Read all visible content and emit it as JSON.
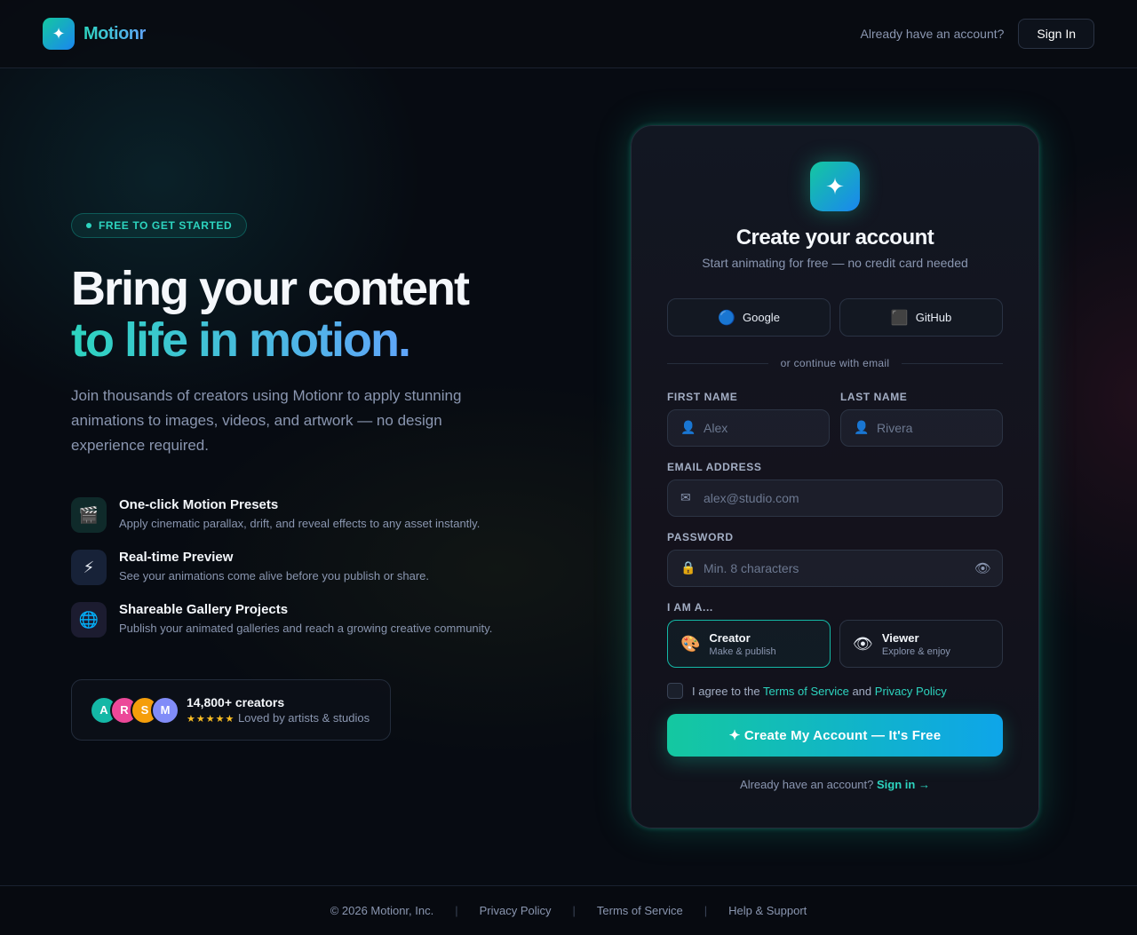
{
  "header": {
    "brand": "Motionr",
    "brand_icon": "sparkle-icon",
    "prompt": "Already have an account?",
    "signin_label": "Sign In"
  },
  "hero": {
    "badge": "FREE TO GET STARTED",
    "title_line1": "Bring your content",
    "title_line2": "to life in motion.",
    "description": "Join thousands of creators using Motionr to apply stunning animations to images, videos, and artwork — no design experience required.",
    "features": [
      {
        "icon": "🎬",
        "icon_name": "clapper-icon",
        "title": "One-click Motion Presets",
        "desc": "Apply cinematic parallax, drift, and reveal effects to any asset instantly."
      },
      {
        "icon": "⚡",
        "icon_name": "lightning-icon",
        "title": "Real-time Preview",
        "desc": "See your animations come alive before you publish or share."
      },
      {
        "icon": "🌐",
        "icon_name": "globe-icon",
        "title": "Shareable Gallery Projects",
        "desc": "Publish your animated galleries and reach a growing creative community."
      }
    ],
    "social": {
      "avatars": [
        "A",
        "R",
        "S",
        "M"
      ],
      "count": "14,800+ creators",
      "stars": "★★★★★",
      "sub": "Loved by artists & studios"
    }
  },
  "form": {
    "title": "Create your account",
    "subtitle": "Start animating for free — no credit card needed",
    "oauth": {
      "google": "Google",
      "github": "GitHub"
    },
    "divider": "or continue with email",
    "first_name": {
      "label": "FIRST NAME",
      "placeholder": "Alex"
    },
    "last_name": {
      "label": "LAST NAME",
      "placeholder": "Rivera"
    },
    "email": {
      "label": "EMAIL ADDRESS",
      "placeholder": "alex@studio.com"
    },
    "password": {
      "label": "PASSWORD",
      "placeholder": "Min. 8 characters"
    },
    "role_label": "I AM A...",
    "roles": [
      {
        "icon": "🎨",
        "name": "Creator",
        "sub": "Make & publish",
        "selected": true
      },
      {
        "icon": "👁",
        "name": "Viewer",
        "sub": "Explore & enjoy",
        "selected": false
      }
    ],
    "agree": {
      "prefix": "I agree to the",
      "tos": "Terms of Service",
      "and": "and",
      "privacy": "Privacy Policy",
      "checked": false
    },
    "submit": "✦ Create My Account — It's Free",
    "footer_prompt": "Already have an account?",
    "footer_link": "Sign in →"
  },
  "footer": {
    "copyright": "© 2026 Motionr, Inc.",
    "links": [
      "Privacy Policy",
      "Terms of Service",
      "Help & Support"
    ],
    "separator": "|"
  },
  "colors": {
    "accent": "#2dd4bf",
    "accent_blue": "#60a5fa",
    "background": "#070b12"
  }
}
